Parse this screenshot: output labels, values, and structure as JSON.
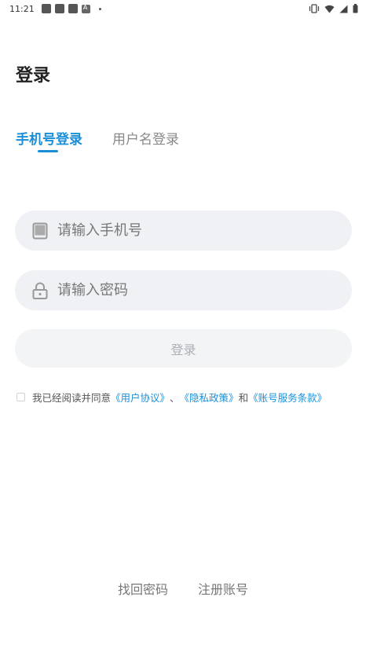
{
  "status_bar": {
    "time": "11:21",
    "notification_icons": [
      "app-notification-icon",
      "app-notification-icon",
      "app-notification-icon",
      "a-notification-icon"
    ],
    "right_icons": [
      "vibrate-icon",
      "wifi-icon",
      "signal-icon",
      "battery-icon"
    ]
  },
  "page": {
    "title": "登录"
  },
  "tabs": [
    {
      "label": "手机号登录",
      "active": true
    },
    {
      "label": "用户名登录",
      "active": false
    }
  ],
  "phone_field": {
    "placeholder": "请输入手机号",
    "value": "",
    "icon": "phone-icon"
  },
  "password_field": {
    "placeholder": "请输入密码",
    "value": "",
    "icon": "lock-icon"
  },
  "login_button": {
    "label": "登录"
  },
  "agreement": {
    "prefix": "我已经阅读并同意",
    "user_agreement": "《用户协议》",
    "sep1": "、",
    "privacy_policy": "《隐私政策》",
    "sep2": "和",
    "account_terms": "《账号服务条款》",
    "checked": false
  },
  "footer": {
    "recover_password": "找回密码",
    "register_account": "注册账号"
  },
  "colors": {
    "accent": "#1a8fd8",
    "input_bg": "#eff1f4",
    "button_disabled_bg": "#f2f4f6",
    "button_disabled_text": "#aab0b6"
  }
}
